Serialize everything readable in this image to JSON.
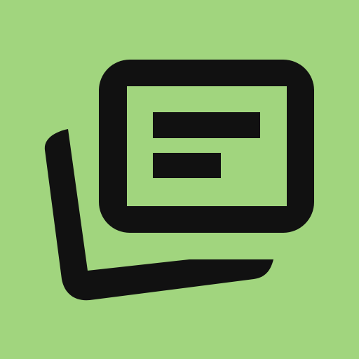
{
  "icon": {
    "name": "cards-stack-icon",
    "background_color": "#a1d57e",
    "foreground_color": "#111111"
  }
}
